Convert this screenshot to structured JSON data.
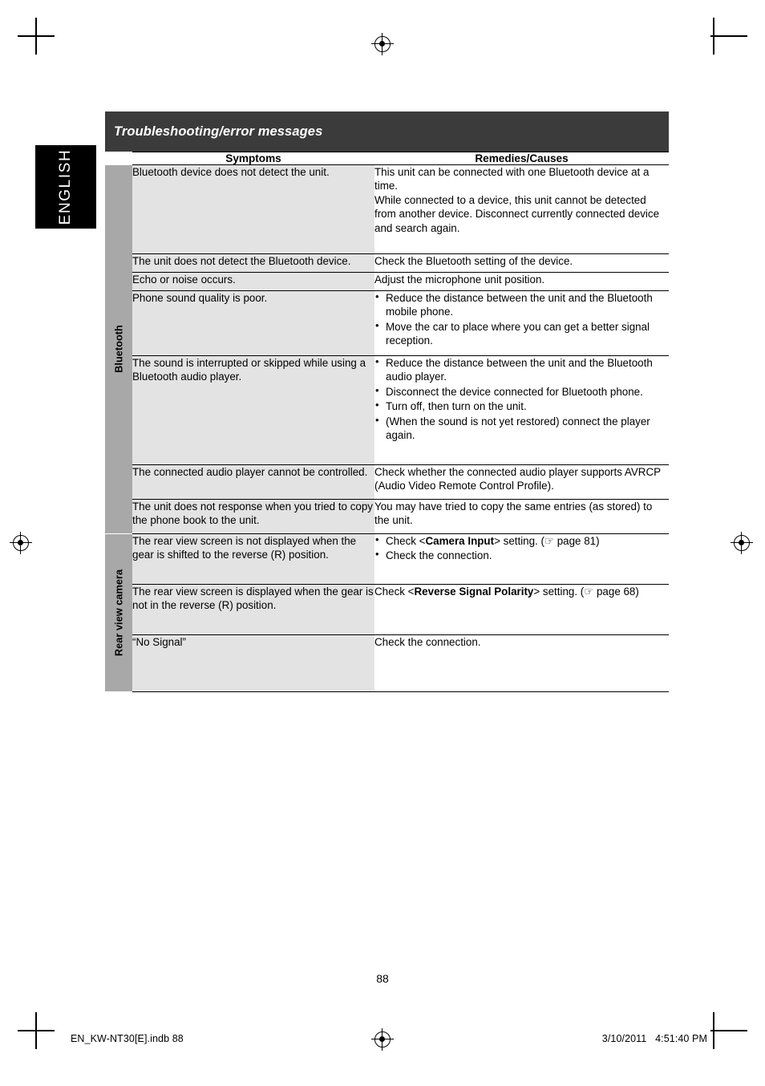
{
  "language_tab": "ENGLISH",
  "section": {
    "title": "Troubleshooting/error messages"
  },
  "table": {
    "columns": {
      "symptoms": "Symptoms",
      "remedies": "Remedies/Causes"
    },
    "categories": [
      {
        "label": "Bluetooth",
        "rows": [
          {
            "symptom": "Bluetooth device does not detect the unit.",
            "remedy_paragraphs": [
              "This unit can be connected with one Bluetooth device at a time.",
              "While connected to a device, this unit cannot be detected from another device. Disconnect currently connected device and search again."
            ]
          },
          {
            "symptom": "The unit does not detect the Bluetooth device.",
            "remedy_paragraphs": [
              "Check the Bluetooth setting of the device."
            ]
          },
          {
            "symptom": "Echo or noise occurs.",
            "remedy_paragraphs": [
              "Adjust the microphone unit position."
            ]
          },
          {
            "symptom": "Phone sound quality is poor.",
            "remedy_bullets": [
              "Reduce the distance between the unit and the Bluetooth mobile phone.",
              "Move the car to place where you can get a better signal reception."
            ]
          },
          {
            "symptom": "The sound is interrupted or skipped while using a Bluetooth audio player.",
            "remedy_bullets": [
              "Reduce the distance between the unit and the Bluetooth audio player.",
              "Disconnect the device connected for Bluetooth phone.",
              "Turn off, then turn on the unit.",
              "(When the sound is not yet restored) connect the player again."
            ]
          },
          {
            "symptom": "The connected audio player cannot be controlled.",
            "remedy_paragraphs": [
              "Check whether the connected audio player supports AVRCP (Audio Video Remote Control Profile)."
            ]
          },
          {
            "symptom": "The unit does not response when you tried to copy the phone book to the unit.",
            "remedy_paragraphs": [
              "You may have tried to copy the same entries (as stored) to the unit."
            ]
          }
        ]
      },
      {
        "label": "Rear view camera",
        "rows": [
          {
            "symptom": "The rear view screen is not displayed when the gear is shifted to the reverse (R) position.",
            "remedy_bullets_rich": [
              {
                "pre": "Check <",
                "bold": "Camera Input",
                "post": "> setting. (☞ page 81)"
              },
              {
                "pre": "Check the connection.",
                "bold": "",
                "post": ""
              }
            ]
          },
          {
            "symptom": "The rear view screen is displayed when the gear is not in the reverse (R) position.",
            "remedy_rich": {
              "pre": "Check <",
              "bold": "Reverse Signal Polarity",
              "post": "> setting. (☞ page 68)"
            }
          },
          {
            "symptom": "“No Signal”",
            "remedy_paragraphs": [
              "Check the connection."
            ]
          }
        ]
      }
    ]
  },
  "page_number": "88",
  "footer": {
    "left": "EN_KW-NT30[E].indb   88",
    "right": "3/10/2011   4:51:40 PM"
  }
}
